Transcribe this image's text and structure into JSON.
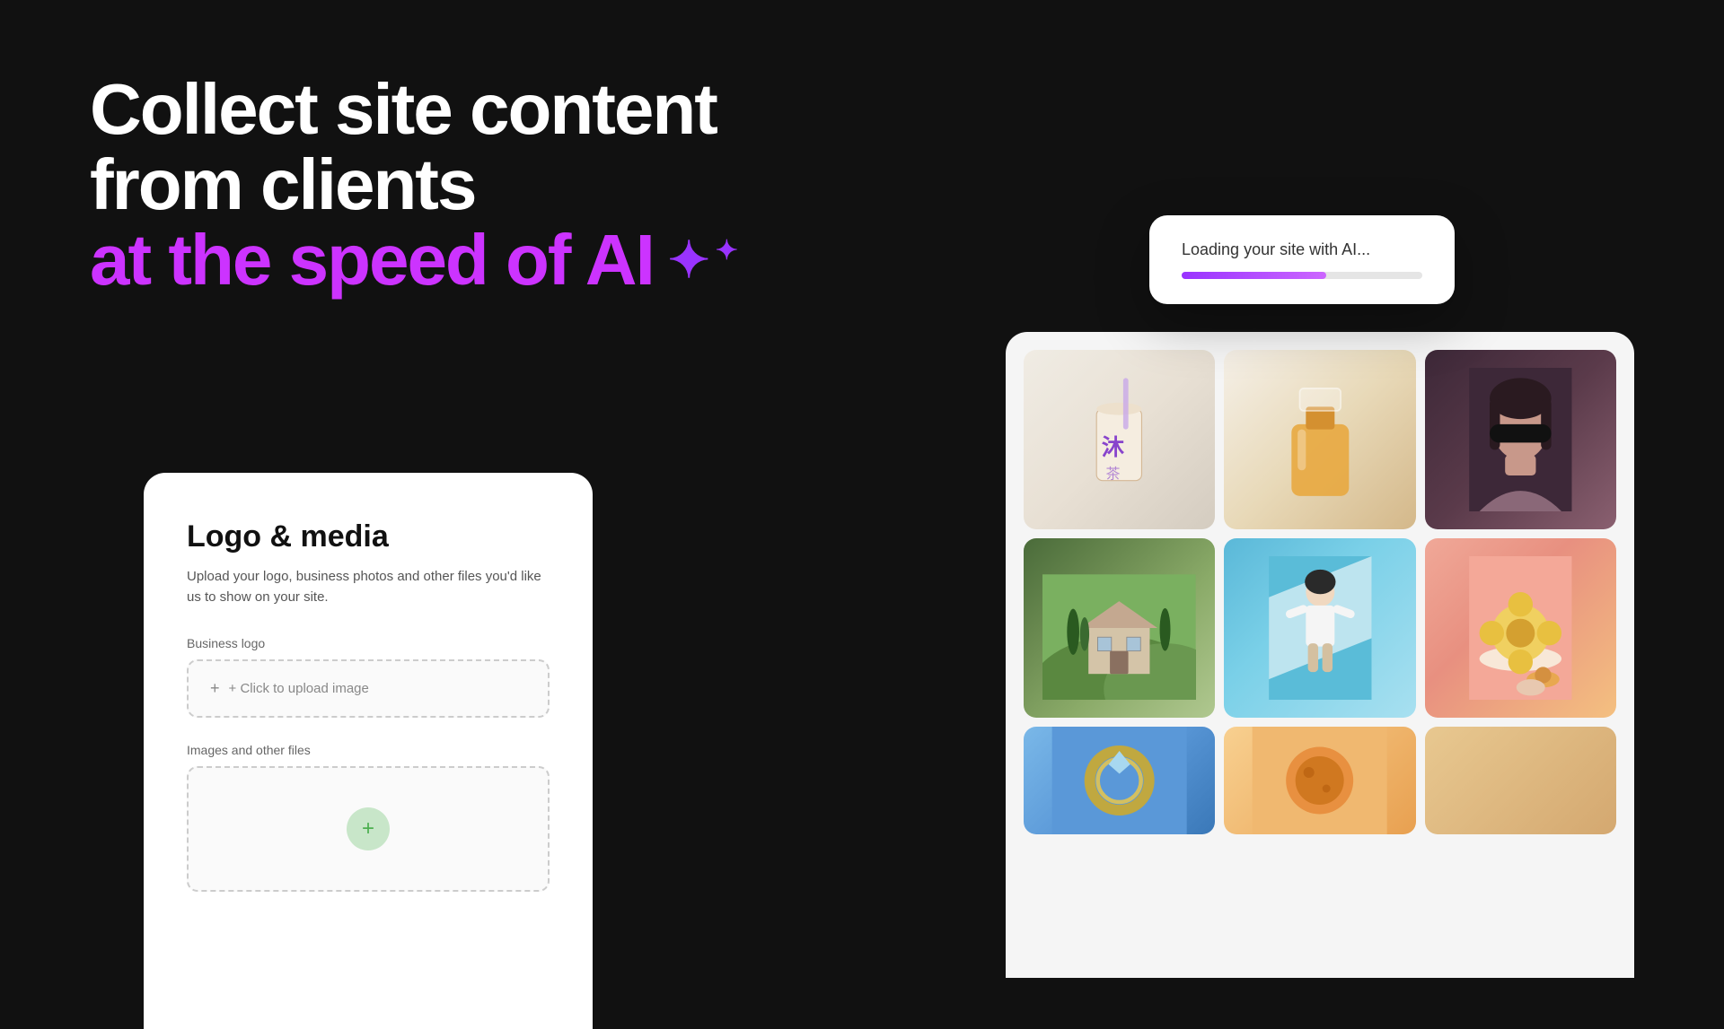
{
  "hero": {
    "line1": "Collect site content",
    "line2": "from clients",
    "line3": "at the speed of AI",
    "sparkle_icon": "✦"
  },
  "loading_card": {
    "text": "Loading your site with AI...",
    "progress_percent": 60
  },
  "form_card": {
    "title": "Logo & media",
    "description": "Upload your logo, business photos and other files you'd like us to show on your site.",
    "business_logo_label": "Business logo",
    "upload_placeholder": "+ Click to upload image",
    "images_label": "Images and other files",
    "add_button": "+"
  },
  "image_grid": {
    "items": [
      {
        "id": "drink",
        "alt": "Drink product"
      },
      {
        "id": "perfume",
        "alt": "Perfume bottle"
      },
      {
        "id": "model",
        "alt": "Model with sunglasses"
      },
      {
        "id": "villa",
        "alt": "Tuscan villa"
      },
      {
        "id": "skater",
        "alt": "Skater girl"
      },
      {
        "id": "pastry",
        "alt": "Pastry on plate"
      },
      {
        "id": "ring",
        "alt": "Ring close-up"
      },
      {
        "id": "food2",
        "alt": "Food item"
      }
    ]
  }
}
